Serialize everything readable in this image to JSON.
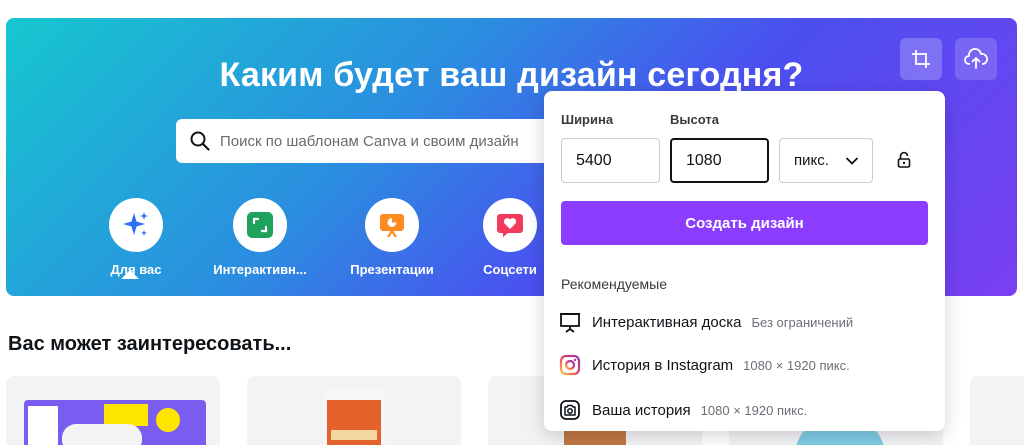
{
  "hero": {
    "title": "Каким будет ваш дизайн сегодня?",
    "search_placeholder": "Поиск по шаблонам Canva и своим дизайн"
  },
  "toolbar": {
    "crop_icon": "crop-icon",
    "upload_icon": "cloud-upload-icon"
  },
  "categories": [
    {
      "label": "Для вас",
      "icon": "sparkle-icon",
      "color": "#2d6ff2",
      "active": true
    },
    {
      "label": "Интерактивн...",
      "icon": "whiteboard-icon",
      "color": "#1fa35c"
    },
    {
      "label": "Презентации",
      "icon": "presentation-icon",
      "color": "#ff8a1f"
    },
    {
      "label": "Соцсети",
      "icon": "heart-icon",
      "color": "#f23b5c"
    }
  ],
  "section": {
    "title": "Вас может заинтересовать..."
  },
  "custom_size": {
    "width_label": "Ширина",
    "height_label": "Высота",
    "width_value": "5400",
    "height_value": "1080",
    "unit": "пикс.",
    "create_label": "Создать дизайн",
    "recommended_title": "Рекомендуемые",
    "recommended": [
      {
        "name": "Интерактивная доска",
        "size": "Без ограничений",
        "icon": "whiteboard-icon"
      },
      {
        "name": "История в Instagram",
        "size": "1080 × 1920 пикс.",
        "icon": "instagram-icon"
      },
      {
        "name": "Ваша история",
        "size": "1080 × 1920 пикс.",
        "icon": "camera-icon"
      }
    ]
  },
  "colors": {
    "accent": "#8b3dff",
    "gradient_start": "#16c7cf",
    "gradient_end": "#7a3ff2"
  }
}
